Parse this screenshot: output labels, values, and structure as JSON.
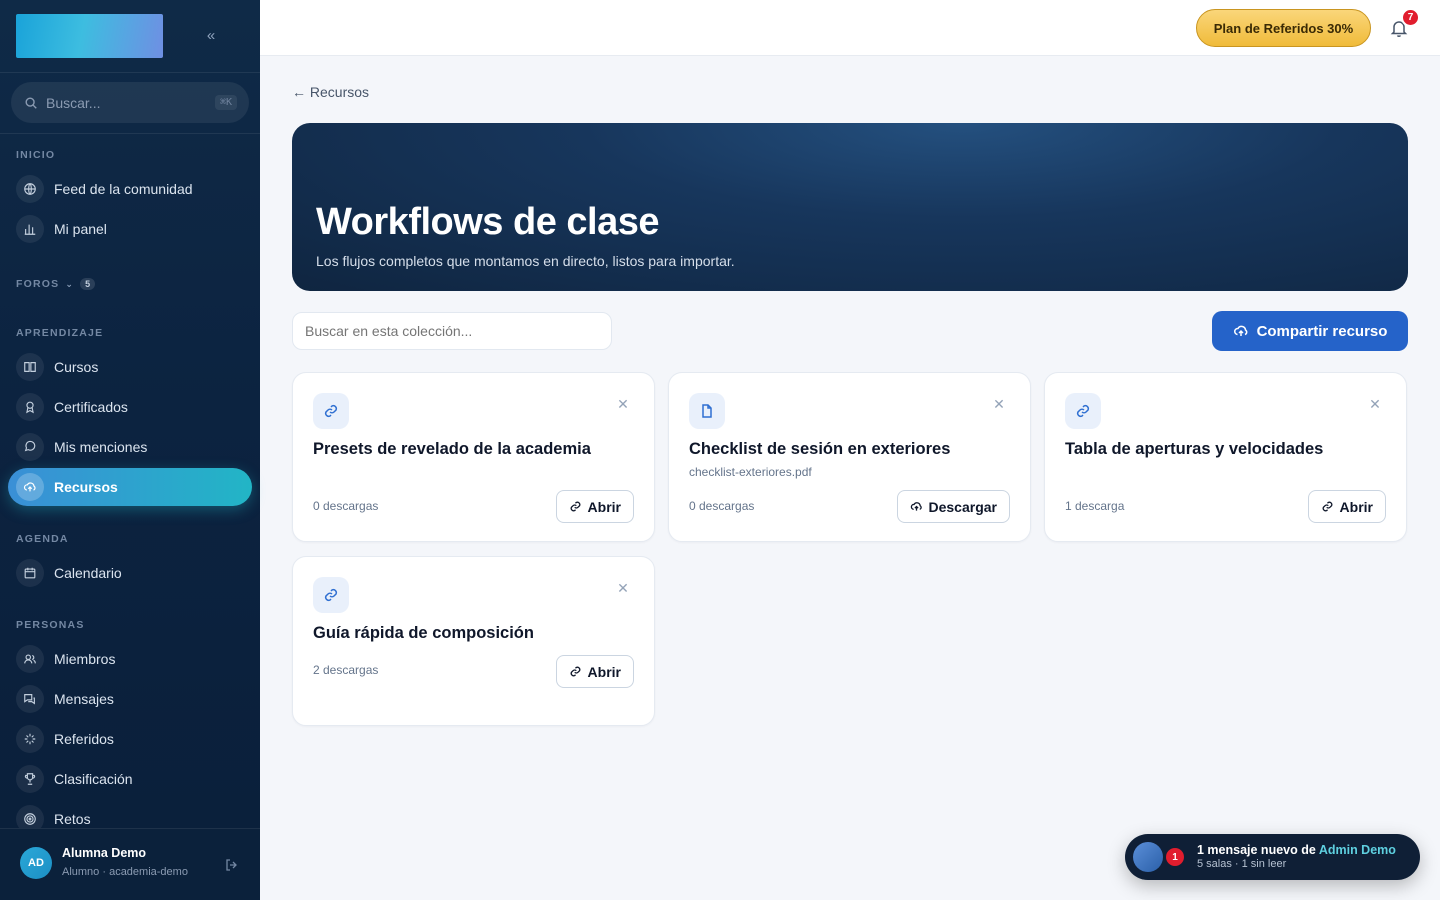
{
  "sidebar": {
    "search": {
      "placeholder": "Buscar...",
      "shortcut": "⌘K"
    },
    "sections": {
      "inicio": "INICIO",
      "foros": "FOROS",
      "foros_count": "5",
      "aprendizaje": "APRENDIZAJE",
      "agenda": "AGENDA",
      "personas": "PERSONAS"
    },
    "items": [
      {
        "label": "Feed de la comunidad",
        "icon": "globe-icon"
      },
      {
        "label": "Mi panel",
        "icon": "bar-chart-icon"
      },
      {
        "label": "Cursos",
        "icon": "book-icon"
      },
      {
        "label": "Certificados",
        "icon": "award-icon"
      },
      {
        "label": "Mis menciones",
        "icon": "message-icon"
      },
      {
        "label": "Recursos",
        "icon": "cloud-upload-icon",
        "active": true
      },
      {
        "label": "Calendario",
        "icon": "calendar-icon"
      },
      {
        "label": "Miembros",
        "icon": "users-icon"
      },
      {
        "label": "Mensajes",
        "icon": "messages-icon"
      },
      {
        "label": "Referidos",
        "icon": "sparkle-icon"
      },
      {
        "label": "Clasificación",
        "icon": "trophy-icon"
      },
      {
        "label": "Retos",
        "icon": "target-icon"
      }
    ],
    "user": {
      "initials": "AD",
      "name": "Alumna Demo",
      "role": "Alumno · academia-demo"
    }
  },
  "topbar": {
    "referral_label": "Plan de Referidos 30%",
    "notifications_count": "7"
  },
  "main": {
    "back_label": "← Recursos",
    "hero": {
      "title": "Workflows de clase",
      "subtitle": "Los flujos completos que montamos en directo, listos para importar."
    },
    "collection_search_placeholder": "Buscar en esta colección...",
    "share_label": "Compartir recurso",
    "cards": [
      {
        "title": "Presets de revelado de la academia",
        "file": "",
        "downloads": "0 descargas",
        "action": "Abrir",
        "type": "link"
      },
      {
        "title": "Checklist de sesión en exteriores",
        "file": "checklist-exteriores.pdf",
        "downloads": "0 descargas",
        "action": "Descargar",
        "type": "file"
      },
      {
        "title": "Tabla de aperturas y velocidades",
        "file": "",
        "downloads": "1 descarga",
        "action": "Abrir",
        "type": "link"
      },
      {
        "title": "Guía rápida de composición",
        "file": "",
        "downloads": "2 descargas",
        "action": "Abrir",
        "type": "link"
      }
    ]
  },
  "toast": {
    "badge": "1",
    "prefix": "1 mensaje nuevo de",
    "sender": "Admin Demo",
    "subtitle": "5 salas · 1 sin leer"
  },
  "colors": {
    "sidebar_bg": "#0f2a47",
    "active_gradient_start": "#3a8fd6",
    "active_gradient_end": "#22b5c6",
    "primary": "#2563c9",
    "referral_gold": "#f0bb3a",
    "badge_red": "#e11d2e"
  }
}
